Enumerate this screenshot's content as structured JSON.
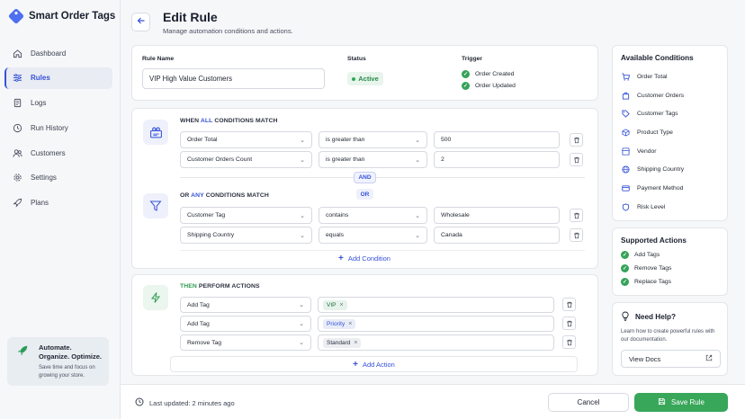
{
  "app": {
    "name": "Smart Order Tags"
  },
  "sidebar": {
    "items": [
      {
        "label": "Dashboard",
        "icon": "home-icon"
      },
      {
        "label": "Rules",
        "icon": "sliders-icon",
        "active": true
      },
      {
        "label": "Logs",
        "icon": "document-icon"
      },
      {
        "label": "Run History",
        "icon": "history-icon"
      },
      {
        "label": "Customers",
        "icon": "users-icon"
      },
      {
        "label": "Settings",
        "icon": "gear-icon"
      },
      {
        "label": "Plans",
        "icon": "rocket-icon"
      }
    ],
    "promo": {
      "title": "Automate. Organize. Optimize.",
      "text": "Save time and focus on growing your store."
    }
  },
  "header": {
    "title": "Edit Rule",
    "subtitle": "Manage automation conditions and actions."
  },
  "rule": {
    "name_label": "Rule Name",
    "name_value": "VIP High Value Customers",
    "status_label": "Status",
    "status_value": "Active",
    "trigger_label": "Trigger",
    "triggers": [
      "Order Created",
      "Order Updated"
    ]
  },
  "conditions": {
    "group1": {
      "prefix": "WHEN",
      "keyword": "ALL",
      "suffix": "CONDITIONS MATCH",
      "rows": [
        {
          "field": "Order Total",
          "operator": "is greater than",
          "value": "500"
        },
        {
          "field": "Customer Orders Count",
          "operator": "is greater than",
          "value": "2"
        }
      ]
    },
    "and_label": "AND",
    "or_label": "OR",
    "group2": {
      "prefix": "OR",
      "keyword": "ANY",
      "suffix": "CONDITIONS MATCH",
      "rows": [
        {
          "field": "Customer Tag",
          "operator": "contains",
          "value": "Wholesale"
        },
        {
          "field": "Shipping Country",
          "operator": "equals",
          "value": "Canada"
        }
      ]
    },
    "add_label": "Add Condition"
  },
  "actions": {
    "prefix": "THEN",
    "suffix": "PERFORM ACTIONS",
    "rows": [
      {
        "action": "Add Tag",
        "tag": "VIP"
      },
      {
        "action": "Add Tag",
        "tag": "Priority"
      },
      {
        "action": "Remove Tag",
        "tag": "Standard"
      }
    ],
    "add_label": "Add Action"
  },
  "available_conditions": {
    "title": "Available Conditions",
    "items": [
      {
        "label": "Order Total",
        "icon": "cart-icon"
      },
      {
        "label": "Customer Orders",
        "icon": "bag-icon"
      },
      {
        "label": "Customer Tags",
        "icon": "tag-icon"
      },
      {
        "label": "Product Type",
        "icon": "box-icon"
      },
      {
        "label": "Vendor",
        "icon": "store-icon"
      },
      {
        "label": "Shipping Country",
        "icon": "globe-icon"
      },
      {
        "label": "Payment Method",
        "icon": "card-icon"
      },
      {
        "label": "Risk Level",
        "icon": "shield-icon"
      }
    ]
  },
  "supported_actions": {
    "title": "Supported Actions",
    "items": [
      "Add Tags",
      "Remove Tags",
      "Replace Tags"
    ]
  },
  "help": {
    "title": "Need Help?",
    "text": "Learn how to create powerful rules with our documentation.",
    "button": "View Docs"
  },
  "footer": {
    "last_updated": "Last updated: 2 minutes ago",
    "cancel": "Cancel",
    "save": "Save Rule"
  },
  "colors": {
    "accent": "#3552d8",
    "success": "#38a75a"
  }
}
